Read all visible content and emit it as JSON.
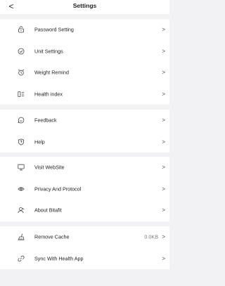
{
  "header": {
    "title": "Settings",
    "back_glyph": "<"
  },
  "chevron": ">",
  "groups": [
    {
      "items": [
        {
          "label": "Password Setting",
          "icon": "lock-icon"
        },
        {
          "label": "Unit Settings",
          "icon": "check-circle-icon"
        },
        {
          "label": "Weight Remind",
          "icon": "alarm-clock-icon"
        },
        {
          "label": "Health index",
          "icon": "list-icon"
        }
      ]
    },
    {
      "items": [
        {
          "label": "Feedback",
          "icon": "smile-bubble-icon"
        },
        {
          "label": "Help",
          "icon": "shield-question-icon"
        }
      ]
    },
    {
      "items": [
        {
          "label": "Visit WebSite",
          "icon": "monitor-icon"
        },
        {
          "label": "Privacy And Protocol",
          "icon": "eye-icon"
        },
        {
          "label": "About Bitafit",
          "icon": "user-icon"
        }
      ]
    },
    {
      "items": [
        {
          "label": "Remove Cache",
          "icon": "broom-icon",
          "value": "0.0KB"
        },
        {
          "label": "Sync With Health App",
          "icon": "link-icon"
        }
      ]
    }
  ]
}
